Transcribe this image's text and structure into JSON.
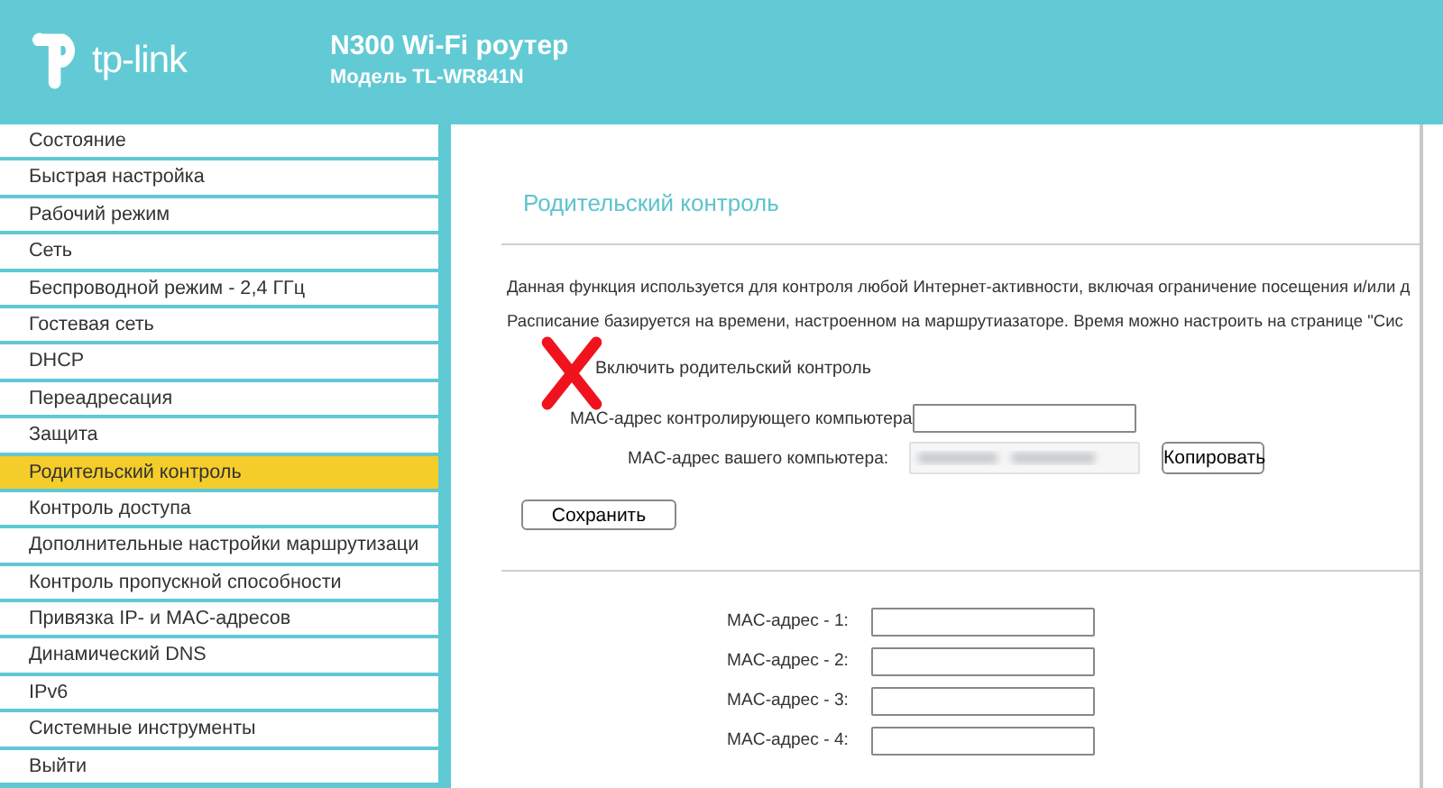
{
  "header": {
    "brand": "tp-link",
    "title": "N300 Wi-Fi роутер",
    "model": "Модель TL-WR841N"
  },
  "sidebar": {
    "items": [
      {
        "label": "Состояние",
        "selected": false
      },
      {
        "label": "Быстрая настройка",
        "selected": false
      },
      {
        "label": "Рабочий режим",
        "selected": false
      },
      {
        "label": "Сеть",
        "selected": false
      },
      {
        "label": "Беспроводной режим - 2,4 ГГц",
        "selected": false
      },
      {
        "label": "Гостевая сеть",
        "selected": false
      },
      {
        "label": "DHCP",
        "selected": false
      },
      {
        "label": "Переадресация",
        "selected": false
      },
      {
        "label": "Защита",
        "selected": false
      },
      {
        "label": "Родительский контроль",
        "selected": true
      },
      {
        "label": "Контроль доступа",
        "selected": false
      },
      {
        "label": "Дополнительные настройки маршрутизаци",
        "selected": false
      },
      {
        "label": "Контроль пропускной способности",
        "selected": false
      },
      {
        "label": "Привязка IP- и MAC-адресов",
        "selected": false
      },
      {
        "label": "Динамический DNS",
        "selected": false
      },
      {
        "label": "IPv6",
        "selected": false
      },
      {
        "label": "Системные инструменты",
        "selected": false
      },
      {
        "label": "Выйти",
        "selected": false
      }
    ]
  },
  "main": {
    "title": "Родительский контроль",
    "description": [
      "Данная функция используется для контроля любой Интернет-активности, включая ограничение посещения и/или д",
      "Расписание базируется на времени, настроенном на маршрутиазаторе. Время можно настроить на странице \"Сис"
    ],
    "enable_label": "Включить родительский контроль",
    "controller_mac_label": "MAC-адрес контролирующего компьютера",
    "your_mac_label": "MAC-адрес вашего компьютера:",
    "copy_button": "Копировать",
    "save_button": "Сохранить",
    "mac_fields": [
      {
        "label": "MAC-адрес - 1:"
      },
      {
        "label": "MAC-адрес - 2:"
      },
      {
        "label": "MAC-адрес - 3:"
      },
      {
        "label": "MAC-адрес - 4:"
      }
    ]
  }
}
